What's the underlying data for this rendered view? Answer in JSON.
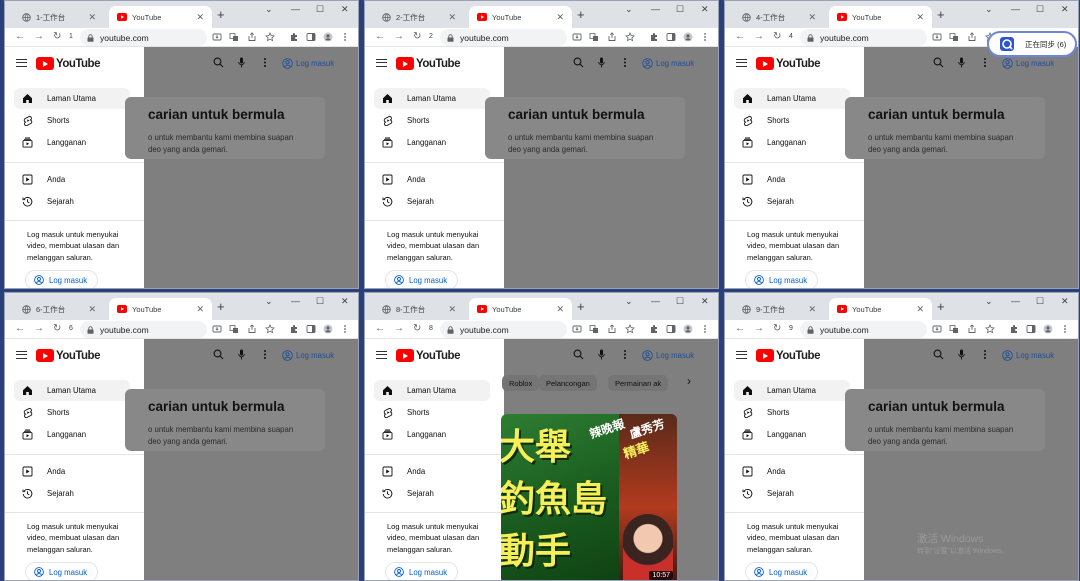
{
  "windows": [
    {
      "workspace_tab": "1-工作台",
      "active_tab": "YouTube",
      "tab_number": "1",
      "url": "youtube.com",
      "variant": "default"
    },
    {
      "workspace_tab": "2-工作台",
      "active_tab": "YouTube",
      "tab_number": "2",
      "url": "youtube.com",
      "variant": "default"
    },
    {
      "workspace_tab": "4-工作台",
      "active_tab": "YouTube",
      "tab_number": "4",
      "url": "youtube.com",
      "variant": "default"
    },
    {
      "workspace_tab": "6-工作台",
      "active_tab": "YouTube",
      "tab_number": "6",
      "url": "youtube.com",
      "variant": "default"
    },
    {
      "workspace_tab": "8-工作台",
      "active_tab": "YouTube",
      "tab_number": "8",
      "url": "youtube.com",
      "variant": "feed"
    },
    {
      "workspace_tab": "9-工作台",
      "active_tab": "YouTube",
      "tab_number": "9",
      "url": "youtube.com",
      "variant": "default"
    }
  ],
  "youtube": {
    "logo_text": "YouTube",
    "nav": [
      "Laman Utama",
      "Shorts",
      "Langganan"
    ],
    "you_nav": [
      "Anda",
      "Sejarah"
    ],
    "signin_prompt": "Log masuk untuk menyukai video, membuat ulasan dan melanggan saluran.",
    "signin_button": "Log masuk",
    "header_login": "Log masuk",
    "empty_title": "carian untuk bermula",
    "empty_subtitle_line1": "o untuk membantu kami membina suapan",
    "empty_subtitle_line2": "deo yang anda gemari.",
    "chips": [
      "Roblox",
      "Pelancongan",
      "Permainan ak"
    ],
    "video_duration": "10:57",
    "thumb_text_1": "大舉",
    "thumb_text_2": "釣魚島",
    "thumb_text_3": "動手",
    "thumb_side_text": "辣晚報",
    "thumb_side_text2": "精華",
    "thumb_name": "盧秀芳"
  },
  "sync_badge": "正在同步 (6)",
  "watermark_line1": "激活 Windows",
  "watermark_line2": "转到\"设置\"以激活 Windows。",
  "colors": {
    "youtube_red": "#ff0000",
    "link_blue": "#065fd4",
    "overlay_gray": "#7f7f7f"
  }
}
